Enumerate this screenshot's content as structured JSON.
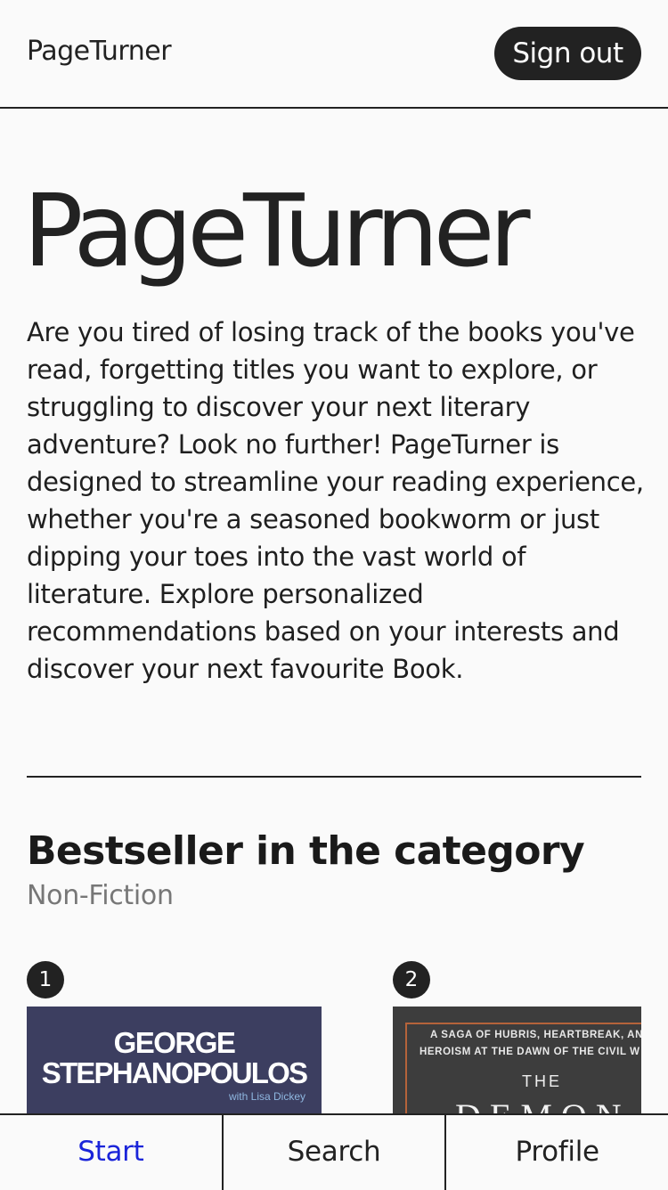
{
  "header": {
    "brand": "PageTurner",
    "signout_label": "Sign out"
  },
  "hero": {
    "title": "PageTurner",
    "text": "Are you tired of losing track of the books you've read, forgetting titles you want to explore, or struggling to discover your next literary adventure? Look no further! PageTurner is designed to streamline your reading experience, whether you're a seasoned bookworm or just dipping your toes into the vast world of literature. Explore personalized recommendations based on your interests and discover your next favourite Book."
  },
  "bestseller": {
    "title": "Bestseller in the category",
    "category": "Non-Fiction",
    "books": [
      {
        "rank": "1",
        "cover_lines": [
          "GEORGE",
          "STEPHANOPOULOS",
          "with Lisa Dickey"
        ]
      },
      {
        "rank": "2",
        "cover_lines": [
          "A SAGA OF HUBRIS, HEARTBREAK, AN",
          "HEROISM AT THE DAWN OF THE CIVIL W",
          "THE",
          "DEMON"
        ]
      }
    ]
  },
  "tabs": [
    {
      "label": "Start",
      "active": true
    },
    {
      "label": "Search",
      "active": false
    },
    {
      "label": "Profile",
      "active": false
    }
  ]
}
